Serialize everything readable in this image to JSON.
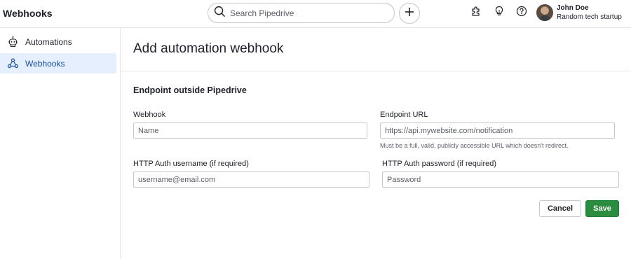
{
  "app": {
    "title": "Webhooks"
  },
  "search": {
    "placeholder": "Search Pipedrive"
  },
  "user": {
    "name": "John Doe",
    "company": "Random tech startup"
  },
  "sidebar": {
    "items": [
      {
        "label": "Automations",
        "icon": "robot-icon",
        "active": false
      },
      {
        "label": "Webhooks",
        "icon": "webhook-icon",
        "active": true
      }
    ]
  },
  "page": {
    "title": "Add automation webhook"
  },
  "form": {
    "section_title": "Endpoint outside Pipedrive",
    "webhook": {
      "label": "Webhook",
      "placeholder": "Name",
      "value": ""
    },
    "endpoint": {
      "label": "Endpoint URL",
      "placeholder": "https://api.mywebsite.com/notification",
      "value": "",
      "hint": "Must be a full, valid, publicly accessible URL which doesn't redirect."
    },
    "auth_username": {
      "label": "HTTP Auth username (if required)",
      "placeholder": "username@email.com",
      "value": ""
    },
    "auth_password": {
      "label": "HTTP Auth password (if required)",
      "placeholder": "Password",
      "value": ""
    },
    "cancel_label": "Cancel",
    "save_label": "Save"
  },
  "colors": {
    "accent": "#2a8c3f",
    "active_bg": "#e5effd",
    "active_text": "#1a4fa0",
    "border": "#c5c7cc"
  }
}
